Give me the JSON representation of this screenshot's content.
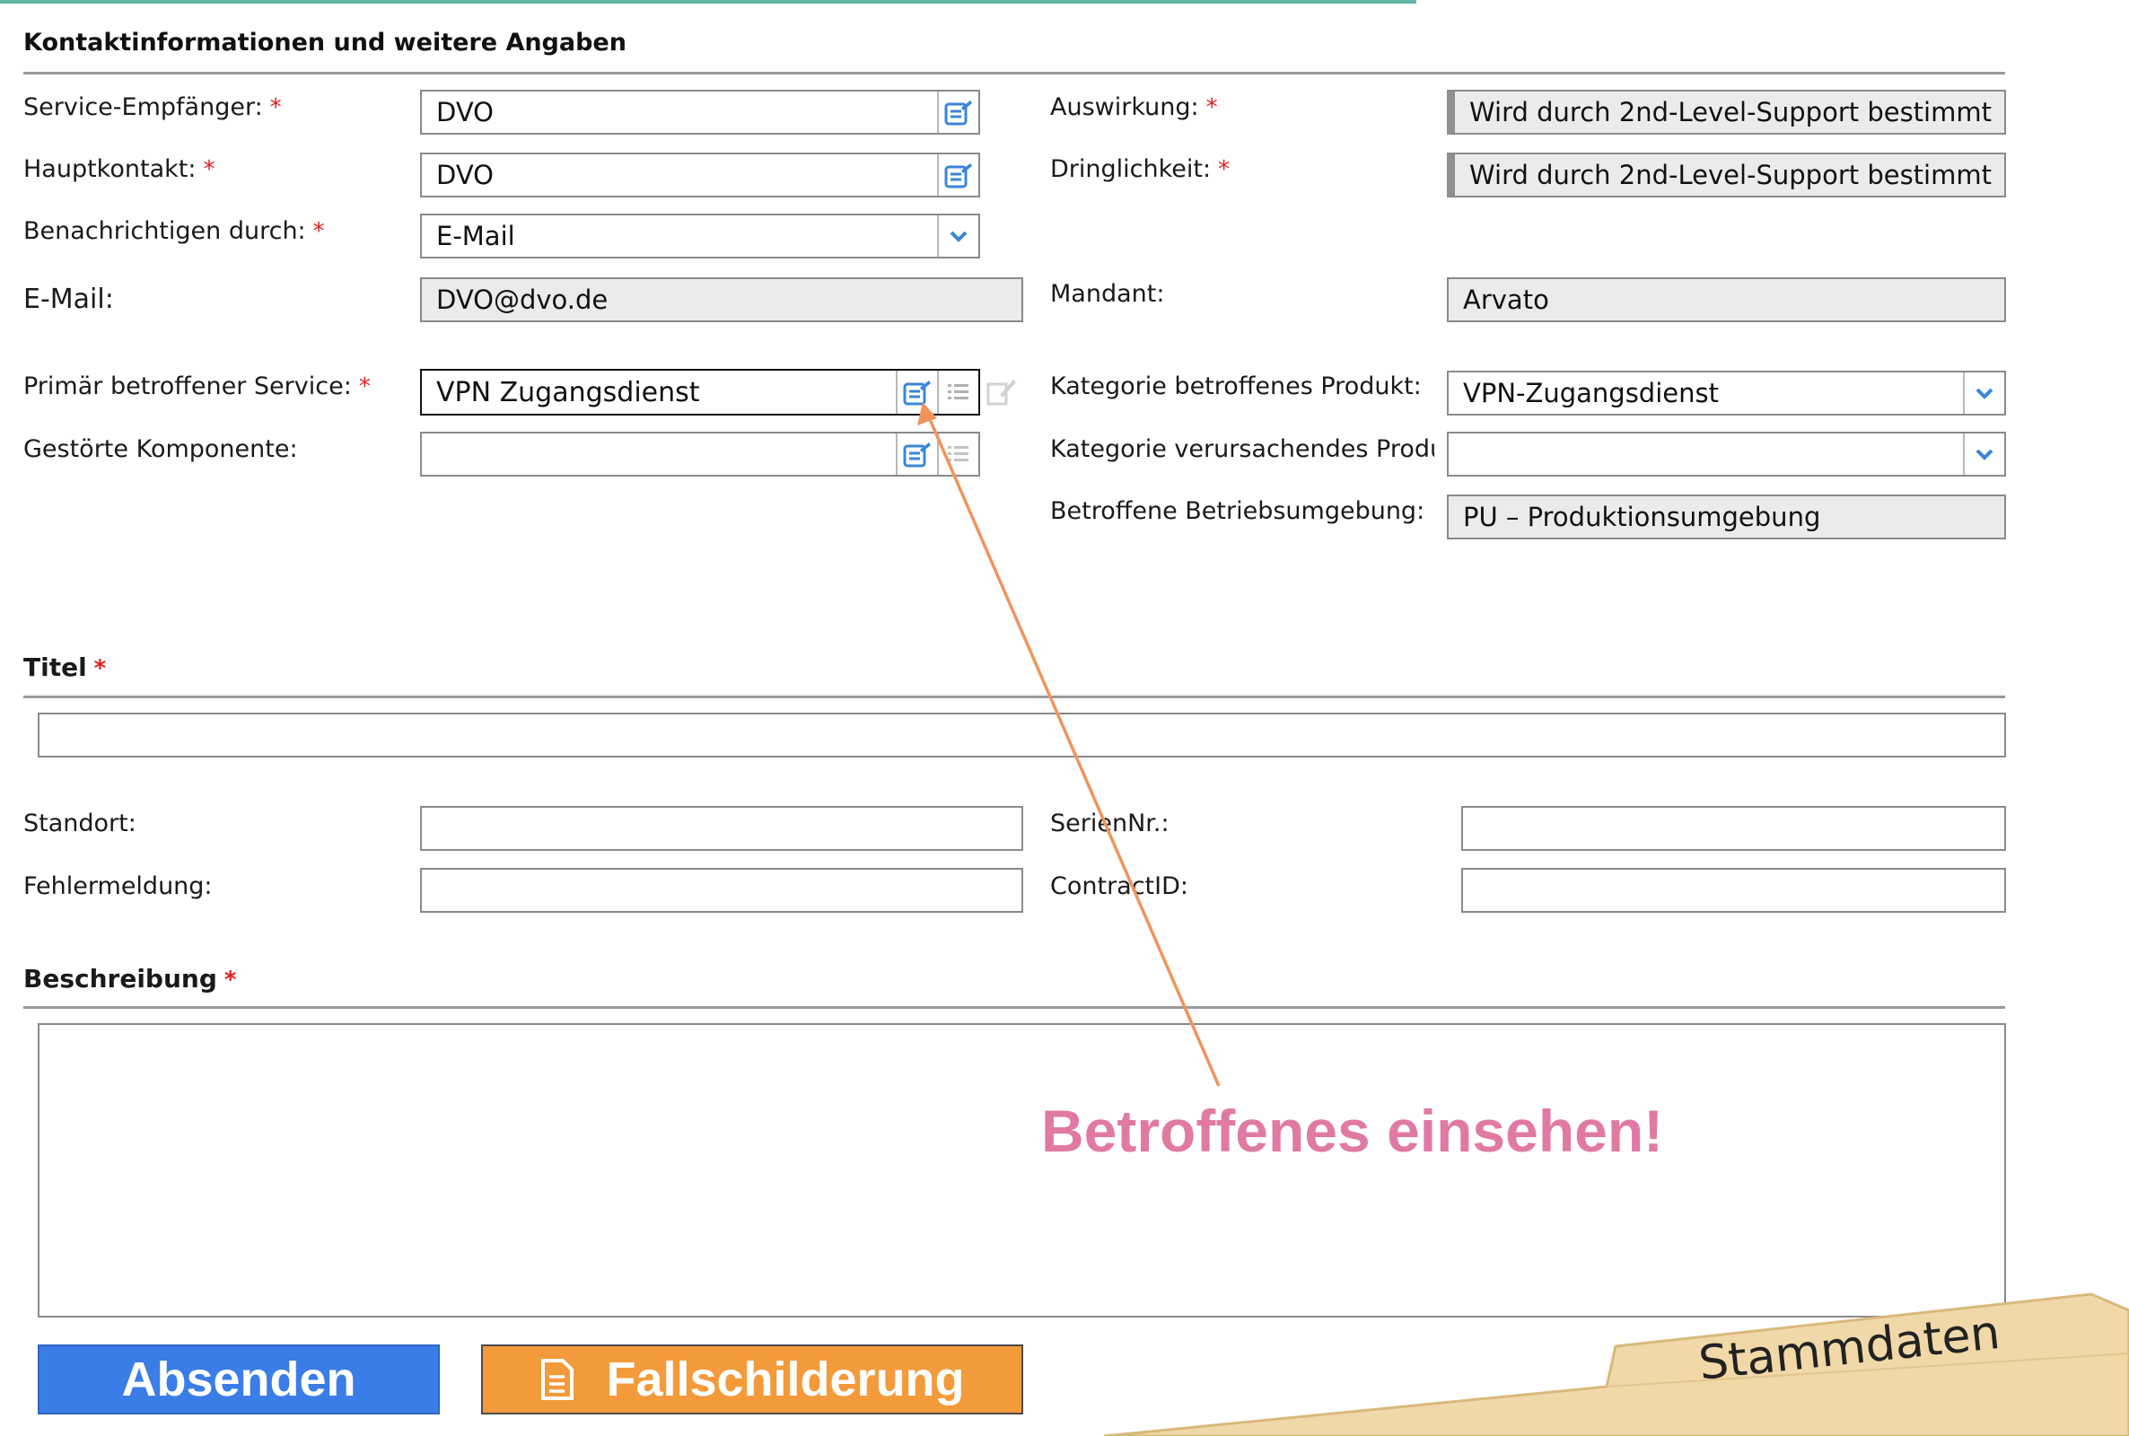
{
  "section": {
    "title": "Kontaktinformationen und weitere Angaben"
  },
  "labels": {
    "service_empfaenger": "Service-Empfänger:",
    "hauptkontakt": "Hauptkontakt:",
    "benachrichtigen": "Benachrichtigen durch:",
    "email": "E-Mail:",
    "primaer_service": "Primär betroffener Service:",
    "gestoerte_komponente": "Gestörte Komponente:",
    "auswirkung": "Auswirkung:",
    "dringlichkeit": "Dringlichkeit:",
    "mandant": "Mandant:",
    "kategorie_betroffen": "Kategorie betroffenes Produkt:",
    "kategorie_verursachend": "Kategorie verursachendes Produkt",
    "betriebsumgebung": "Betroffene Betriebsumgebung:",
    "titel": "Titel",
    "standort": "Standort:",
    "fehlermeldung": "Fehlermeldung:",
    "seriennr": "SerienNr.:",
    "contractid": "ContractID:",
    "beschreibung": "Beschreibung"
  },
  "required_mark": "*",
  "values": {
    "service_empfaenger": "DVO",
    "hauptkontakt": "DVO",
    "benachrichtigen": "E-Mail",
    "email": "DVO@dvo.de",
    "primaer_service": "VPN Zugangsdienst",
    "gestoerte_komponente": "",
    "auswirkung": "Wird durch 2nd-Level-Support bestimmt",
    "dringlichkeit": "Wird durch 2nd-Level-Support bestimmt",
    "mandant": "Arvato",
    "kategorie_betroffen": "VPN-Zugangsdienst",
    "kategorie_verursachend": "",
    "betriebsumgebung": "PU – Produktionsumgebung",
    "titel": "",
    "standort": "",
    "fehlermeldung": "",
    "seriennr": "",
    "contractid": "",
    "beschreibung": ""
  },
  "buttons": {
    "absenden": "Absenden",
    "fallschilderung": "Fallschilderung"
  },
  "annotation": "Betroffenes einsehen!",
  "tab": "Stammdaten",
  "colors": {
    "required": "#e02020",
    "accent_line": "#5fb5a6",
    "absenden_bg": "#3a7de6",
    "fallschilderung_bg": "#f39a3a",
    "annotation": "#e07aa3",
    "arrow": "#f0945c",
    "tab_bg": "#f1d8a8",
    "icon_blue": "#3a86d8"
  },
  "icons": [
    "lookup-icon",
    "list-icon",
    "edit-icon",
    "chevron-down-icon",
    "document-icon"
  ]
}
